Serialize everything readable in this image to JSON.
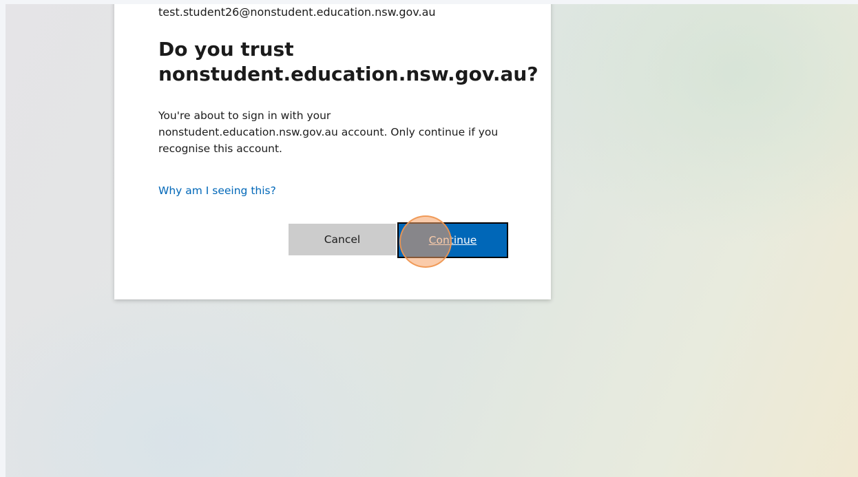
{
  "dialog": {
    "identity": "test.student26@nonstudent.education.nsw.gov.au",
    "title": "Do you trust nonstudent.education.nsw.gov.au?",
    "description": "You're about to sign in with your nonstudent.education.nsw.gov.au account. Only continue if you recognise this account.",
    "help_link": "Why am I seeing this?",
    "cancel_label": "Cancel",
    "continue_label": "Continue"
  },
  "colors": {
    "primary": "#0067b8",
    "secondary_button": "#cccccc",
    "click_indicator": "#f5a064"
  }
}
